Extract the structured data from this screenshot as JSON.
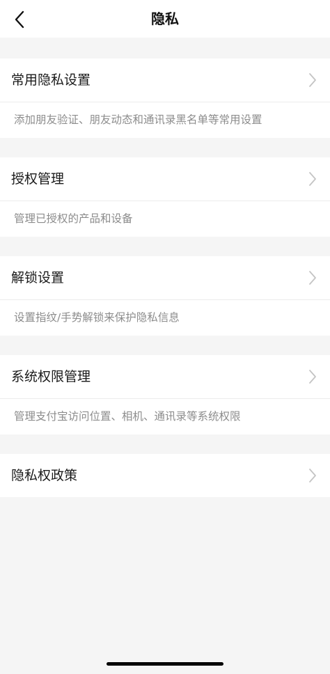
{
  "nav": {
    "title": "隐私",
    "back_icon": "chevron-left-icon"
  },
  "items": [
    {
      "id": "common-privacy-settings",
      "label": "常用隐私设置",
      "description": "添加朋友验证、朋友动态和通讯录黑名单等常用设置"
    },
    {
      "id": "authorization-management",
      "label": "授权管理",
      "description": "管理已授权的产品和设备"
    },
    {
      "id": "unlock-settings",
      "label": "解锁设置",
      "description": "设置指纹/手势解锁来保护隐私信息"
    },
    {
      "id": "system-permission-management",
      "label": "系统权限管理",
      "description": "管理支付宝访问位置、相机、通讯录等系统权限"
    },
    {
      "id": "privacy-policy",
      "label": "隐私权政策",
      "description": ""
    }
  ],
  "colors": {
    "background": "#f5f5f5",
    "row": "#ffffff",
    "label": "#1a1a1a",
    "description": "#8c8c8c",
    "chevron": "#c4c4c4"
  }
}
